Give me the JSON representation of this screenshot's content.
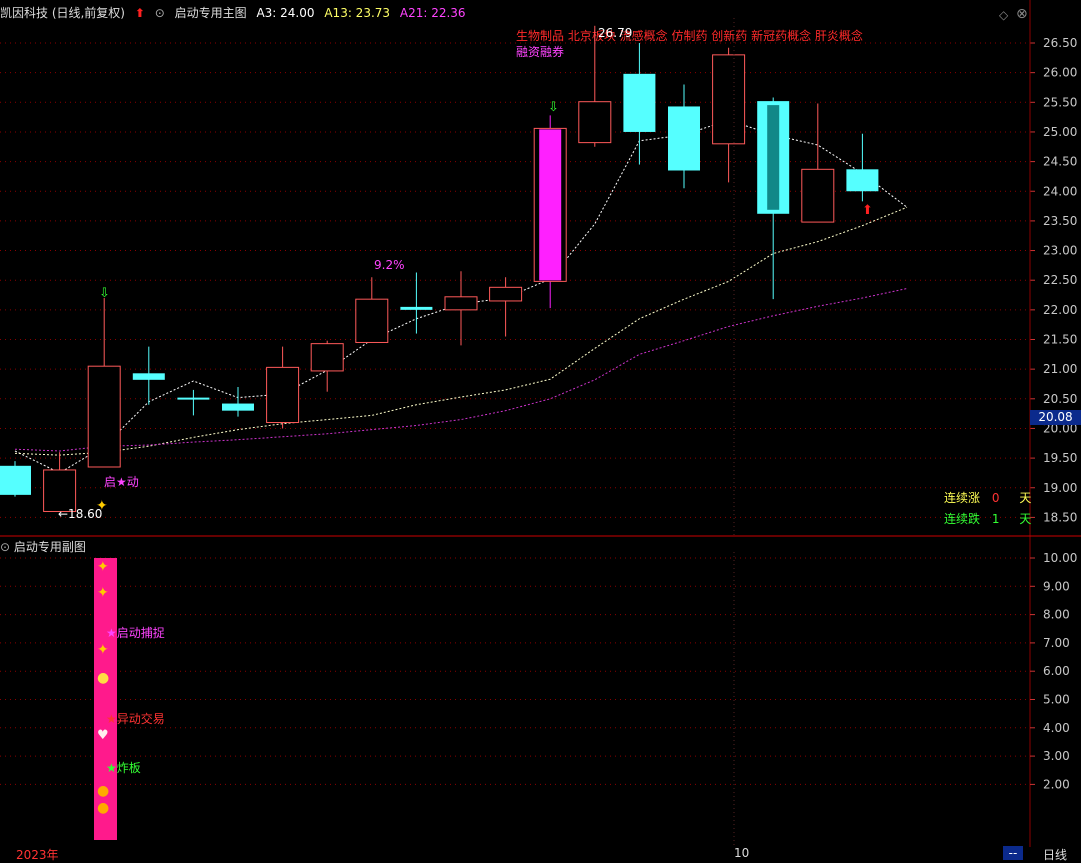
{
  "header": {
    "stock_name": "凯因科技 (日线,前复权)",
    "indicator_name": "启动专用主图",
    "a3": "A3: 24.00",
    "a13": "A13: 23.73",
    "a21": "A21: 22.36"
  },
  "concepts": {
    "line1": "生物制品 北京板块 流感概念 仿制药 创新药 新冠药概念 肝炎概念",
    "line2": "融资融券"
  },
  "annotations": {
    "high_label": "26.79",
    "low_label": "←18.60",
    "pct_label": "9.2%",
    "start_label": "启★动",
    "last_price": "20.08"
  },
  "streaks": {
    "up_label": "连续涨",
    "up_value": "0",
    "up_unit": "天",
    "down_label": "连续跌",
    "down_value": "1",
    "down_unit": "天"
  },
  "sub_panel": {
    "title": "启动专用副图",
    "label_capture": "★启动捕捉",
    "label_trade": "★异动交易",
    "label_board": "★炸板",
    "axis": [
      "10.00",
      "9.00",
      "8.00",
      "7.00",
      "6.00",
      "5.00",
      "4.00",
      "3.00",
      "2.00"
    ]
  },
  "footer": {
    "year": "2023年",
    "month": "10",
    "period": "日线",
    "scroll": "--"
  },
  "colors": {
    "up": "#ff5a5a",
    "down": "#55ffff",
    "limit_up": "#ff20ff",
    "ma_a3": "#ffffff",
    "ma_a13": "#ffffcc",
    "ma_a21": "#cc33cc",
    "grid": "#8b0000",
    "signal_bar": "#ff1a8c"
  },
  "chart_data": {
    "type": "candlestick",
    "y_range": [
      18.4,
      26.8
    ],
    "y_ticks": [
      "26.50",
      "26.00",
      "25.50",
      "25.00",
      "24.50",
      "24.00",
      "23.50",
      "23.00",
      "22.50",
      "22.00",
      "21.50",
      "21.00",
      "20.50",
      "20.00",
      "19.50",
      "19.00",
      "18.50"
    ],
    "candles": [
      {
        "o": 19.37,
        "h": 19.45,
        "l": 18.85,
        "c": 18.88
      },
      {
        "o": 18.6,
        "h": 19.6,
        "l": 18.6,
        "c": 19.3
      },
      {
        "o": 19.35,
        "h": 22.2,
        "l": 19.35,
        "c": 21.05
      },
      {
        "o": 20.93,
        "h": 21.38,
        "l": 20.4,
        "c": 20.82
      },
      {
        "o": 20.52,
        "h": 20.65,
        "l": 20.22,
        "c": 20.5
      },
      {
        "o": 20.42,
        "h": 20.7,
        "l": 20.2,
        "c": 20.3
      },
      {
        "o": 20.1,
        "h": 21.38,
        "l": 20.0,
        "c": 21.03
      },
      {
        "o": 20.97,
        "h": 21.48,
        "l": 20.62,
        "c": 21.43
      },
      {
        "o": 21.45,
        "h": 22.55,
        "l": 21.45,
        "c": 22.18
      },
      {
        "o": 22.05,
        "h": 22.63,
        "l": 21.6,
        "c": 22.0
      },
      {
        "o": 22.0,
        "h": 22.65,
        "l": 21.4,
        "c": 22.22
      },
      {
        "o": 22.15,
        "h": 22.55,
        "l": 21.55,
        "c": 22.38
      },
      {
        "o": 22.48,
        "h": 25.28,
        "l": 22.03,
        "c": 25.06
      },
      {
        "o": 24.82,
        "h": 26.79,
        "l": 24.75,
        "c": 25.51
      },
      {
        "o": 25.98,
        "h": 26.5,
        "l": 24.45,
        "c": 25.0
      },
      {
        "o": 25.43,
        "h": 25.8,
        "l": 24.05,
        "c": 24.35
      },
      {
        "o": 24.8,
        "h": 26.42,
        "l": 24.15,
        "c": 26.3
      },
      {
        "o": 25.52,
        "h": 25.58,
        "l": 22.18,
        "c": 23.62
      },
      {
        "o": 23.48,
        "h": 25.48,
        "l": 23.48,
        "c": 24.37
      },
      {
        "o": 24.37,
        "h": 24.97,
        "l": 23.83,
        "c": 24.0
      }
    ],
    "series": [
      {
        "name": "A3",
        "values": [
          19.62,
          19.25,
          19.7,
          20.45,
          20.8,
          20.52,
          20.58,
          20.98,
          21.5,
          21.85,
          22.1,
          22.2,
          22.52,
          23.45,
          24.85,
          24.95,
          25.2,
          24.95,
          24.78,
          24.3,
          23.73
        ]
      },
      {
        "name": "A13",
        "values": [
          19.58,
          19.55,
          19.6,
          19.7,
          19.85,
          19.98,
          20.08,
          20.15,
          20.22,
          20.4,
          20.53,
          20.65,
          20.83,
          21.35,
          21.85,
          22.18,
          22.48,
          22.95,
          23.15,
          23.42,
          23.73
        ]
      },
      {
        "name": "A21",
        "values": [
          19.65,
          19.62,
          19.7,
          19.72,
          19.77,
          19.81,
          19.86,
          19.91,
          19.98,
          20.05,
          20.15,
          20.3,
          20.5,
          20.82,
          21.25,
          21.48,
          21.72,
          21.9,
          22.06,
          22.2,
          22.36
        ]
      }
    ]
  }
}
